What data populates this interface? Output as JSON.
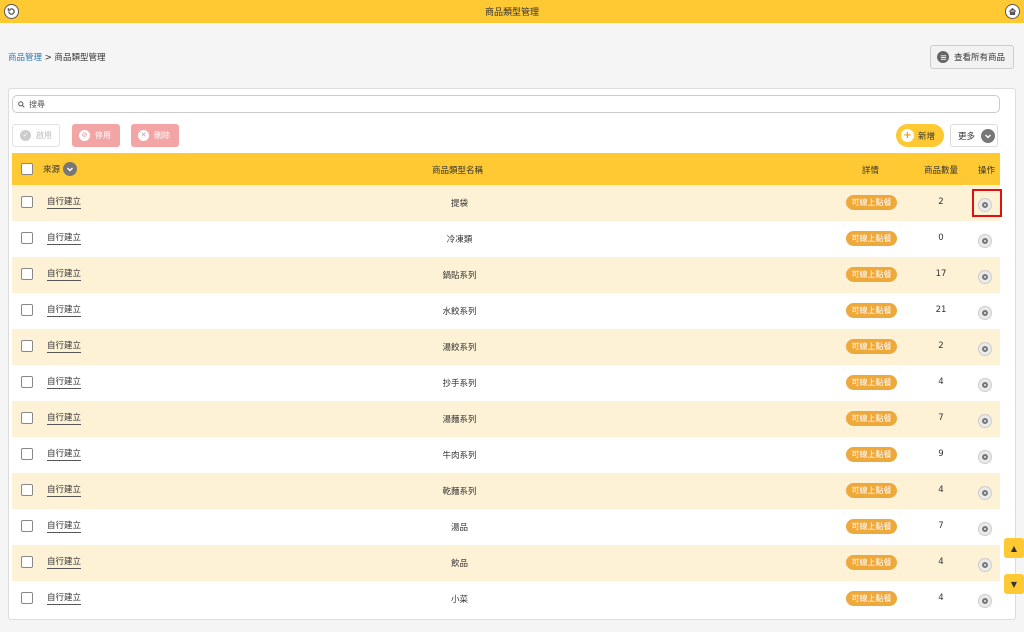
{
  "header": {
    "title": "商品類型管理",
    "back_icon": "refresh-back-icon",
    "home_icon": "home-icon"
  },
  "breadcrumb": {
    "parent": "商品管理",
    "separator": ">",
    "current": "商品類型管理"
  },
  "view_all_button": {
    "label": "查看所有商品",
    "icon": "list-icon"
  },
  "search": {
    "placeholder": "搜尋",
    "icon": "search-icon"
  },
  "toolbar": {
    "enable_label": "啟用",
    "disable_label": "停用",
    "delete_label": "刪除",
    "add_label": "新增",
    "more_label": "更多"
  },
  "table": {
    "columns": {
      "source": "來源",
      "name": "商品類型名稱",
      "detail": "詳情",
      "count": "商品數量",
      "operation": "操作"
    },
    "rows": [
      {
        "source": "自行建立",
        "name": "提袋",
        "detail": "可線上點餐",
        "count": "2"
      },
      {
        "source": "自行建立",
        "name": "冷凍類",
        "detail": "可線上點餐",
        "count": "0"
      },
      {
        "source": "自行建立",
        "name": "鍋貼系列",
        "detail": "可線上點餐",
        "count": "17"
      },
      {
        "source": "自行建立",
        "name": "水餃系列",
        "detail": "可線上點餐",
        "count": "21"
      },
      {
        "source": "自行建立",
        "name": "湯餃系列",
        "detail": "可線上點餐",
        "count": "2"
      },
      {
        "source": "自行建立",
        "name": "抄手系列",
        "detail": "可線上點餐",
        "count": "4"
      },
      {
        "source": "自行建立",
        "name": "湯麵系列",
        "detail": "可線上點餐",
        "count": "7"
      },
      {
        "source": "自行建立",
        "name": "牛肉系列",
        "detail": "可線上點餐",
        "count": "9"
      },
      {
        "source": "自行建立",
        "name": "乾麵系列",
        "detail": "可線上點餐",
        "count": "4"
      },
      {
        "source": "自行建立",
        "name": "湯品",
        "detail": "可線上點餐",
        "count": "7"
      },
      {
        "source": "自行建立",
        "name": "飲品",
        "detail": "可線上點餐",
        "count": "4"
      },
      {
        "source": "自行建立",
        "name": "小菜",
        "detail": "可線上點餐",
        "count": "4"
      }
    ]
  },
  "scroll": {
    "up": "▲",
    "down": "▼"
  },
  "colors": {
    "accent": "#ffc933",
    "row_alt": "#fdf2d6",
    "badge": "#efa83a",
    "danger_soft": "#f3a5a5",
    "highlight": "#e01010"
  }
}
